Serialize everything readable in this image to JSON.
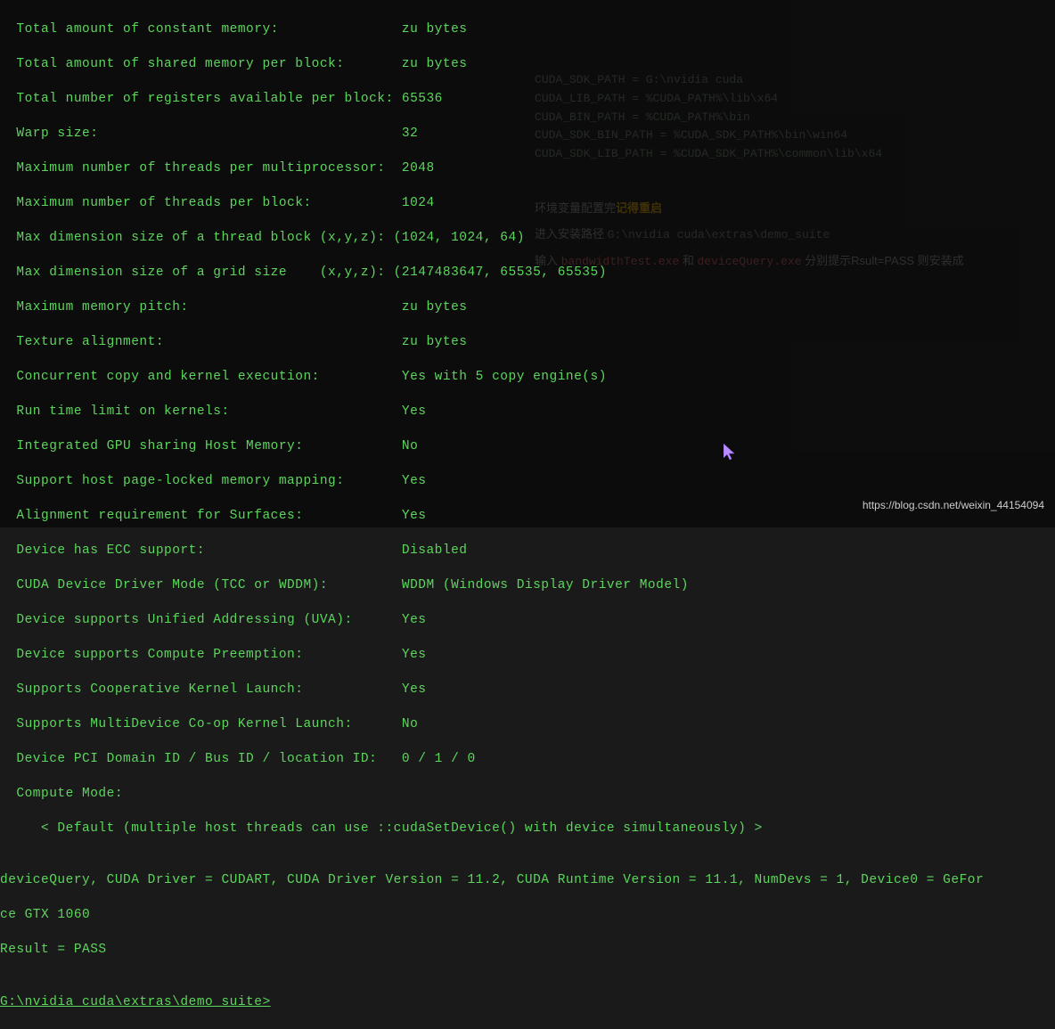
{
  "bg": {
    "env1": "CUDA_SDK_PATH = G:\\nvidia cuda",
    "env2": "CUDA_LIB_PATH = %CUDA_PATH%\\lib\\x64",
    "env3": "CUDA_BIN_PATH = %CUDA_PATH%\\bin",
    "env4": "CUDA_SDK_BIN_PATH = %CUDA_SDK_PATH%\\bin\\win64",
    "env5": "CUDA_SDK_LIB_PATH = %CUDA_SDK_PATH%\\common\\lib\\x64",
    "cn_line1_a": "环境变量配置完",
    "cn_line1_b": "记得重启",
    "cn_line2_a": "进入安装路径 ",
    "cn_line2_b": "G:\\nvidia cuda\\extras\\demo_suite",
    "cn_line3_a": "输入 ",
    "cn_line3_b": "bandwidthTest.exe",
    "cn_line3_c": " 和 ",
    "cn_line3_d": "deviceQuery.exe",
    "cn_line3_e": " 分别提示Rsult=PASS 则安装成"
  },
  "terminal": {
    "l01": "  Total amount of constant memory:               zu bytes",
    "l02": "  Total amount of shared memory per block:       zu bytes",
    "l03": "  Total number of registers available per block: 65536",
    "l04": "  Warp size:                                     32",
    "l05": "  Maximum number of threads per multiprocessor:  2048",
    "l06": "  Maximum number of threads per block:           1024",
    "l07": "  Max dimension size of a thread block (x,y,z): (1024, 1024, 64)",
    "l08": "  Max dimension size of a grid size    (x,y,z): (2147483647, 65535, 65535)",
    "l09": "  Maximum memory pitch:                          zu bytes",
    "l10": "  Texture alignment:                             zu bytes",
    "l11": "  Concurrent copy and kernel execution:          Yes with 5 copy engine(s)",
    "l12": "  Run time limit on kernels:                     Yes",
    "l13": "  Integrated GPU sharing Host Memory:            No",
    "l14": "  Support host page-locked memory mapping:       Yes",
    "l15": "  Alignment requirement for Surfaces:            Yes",
    "l16": "  Device has ECC support:                        Disabled",
    "l17": "  CUDA Device Driver Mode (TCC or WDDM):         WDDM (Windows Display Driver Model)",
    "l18": "  Device supports Unified Addressing (UVA):      Yes",
    "l19": "  Device supports Compute Preemption:            Yes",
    "l20": "  Supports Cooperative Kernel Launch:            Yes",
    "l21": "  Supports MultiDevice Co-op Kernel Launch:      No",
    "l22": "  Device PCI Domain ID / Bus ID / location ID:   0 / 1 / 0",
    "l23": "  Compute Mode:",
    "l24": "     < Default (multiple host threads can use ::cudaSetDevice() with device simultaneously) >",
    "l25": "",
    "l26": "deviceQuery, CUDA Driver = CUDART, CUDA Driver Version = 11.2, CUDA Runtime Version = 11.1, NumDevs = 1, Device0 = GeFor",
    "l27": "ce GTX 1060",
    "l28": "Result = PASS",
    "l29": "",
    "prompt": "G:\\nvidia cuda\\extras\\demo_suite>"
  },
  "watermark": "https://blog.csdn.net/weixin_44154094"
}
